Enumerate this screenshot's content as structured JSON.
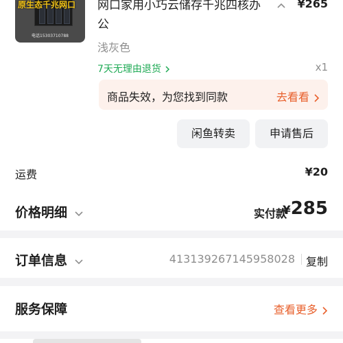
{
  "product": {
    "thumbnail_banner": "原生态千兆网口",
    "thumbnail_phone": "电话15303710788",
    "title": "网口家用小巧云储存千兆四核办公",
    "price": "¥265",
    "sku": "浅灰色",
    "return_policy": "7天无理由退货",
    "quantity": "x1"
  },
  "invalid_notice": {
    "text": "商品失效，为您找到同款",
    "link": "去看看"
  },
  "actions": {
    "resell": "闲鱼转卖",
    "after_sale": "申请售后"
  },
  "shipping": {
    "label": "运费",
    "value": "¥20"
  },
  "price_detail": {
    "label": "价格明细",
    "paid_label": "实付款",
    "currency": "¥",
    "paid_amount": "285"
  },
  "order_info": {
    "label": "订单信息",
    "order_number": "4131392671459580​28",
    "copy": "复制"
  },
  "service": {
    "label": "服务保障",
    "link": "查看更多"
  },
  "colors": {
    "accent_orange": "#e8602c",
    "green": "#1faa55",
    "notice_bg": "#fdf1ec"
  }
}
